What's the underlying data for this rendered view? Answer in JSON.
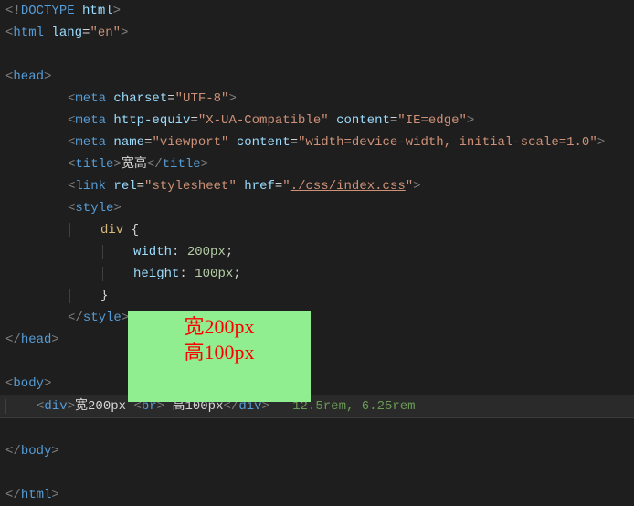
{
  "doctype": {
    "open": "<!",
    "name": "DOCTYPE",
    "arg": " html",
    "close": ">"
  },
  "html": {
    "tag": "html",
    "lang_attr": "lang",
    "lang_val": "\"en\""
  },
  "tags": {
    "head": "head",
    "meta": "meta",
    "title": "title",
    "link": "link",
    "style": "style",
    "body": "body",
    "div": "div",
    "br": "br",
    "html_close": "html"
  },
  "meta1": {
    "a1": "charset",
    "v1": "\"UTF-8\""
  },
  "meta2": {
    "a1": "http-equiv",
    "v1": "\"X-UA-Compatible\"",
    "a2": "content",
    "v2": "\"IE=edge\""
  },
  "meta3": {
    "a1": "name",
    "v1": "\"viewport\"",
    "a2": "content",
    "v2": "\"width=device-width, initial-scale=1.0\""
  },
  "title_text": "宽高",
  "link": {
    "a1": "rel",
    "v1": "\"stylesheet\"",
    "a2": "href",
    "v2_open": "\"",
    "v2_path": "./css/index.css",
    "v2_close": "\""
  },
  "css": {
    "selector": "div",
    "brace_open": "{",
    "prop1": "width",
    "val1_num": "200",
    "val1_unit": "px",
    "prop2": "height",
    "val2_num": "100",
    "val2_unit": "px",
    "brace_close": "}"
  },
  "content": {
    "div_text1": "宽200px ",
    "div_text2": " 高100px",
    "comment": "12.5rem, 6.25rem"
  },
  "overlay": {
    "line1": "宽200px",
    "line2": "高100px"
  },
  "punct": {
    "lt": "<",
    "gt": ">",
    "lts": "</",
    "eq": "=",
    "col": ":",
    "semi": ";",
    "sp": " "
  }
}
